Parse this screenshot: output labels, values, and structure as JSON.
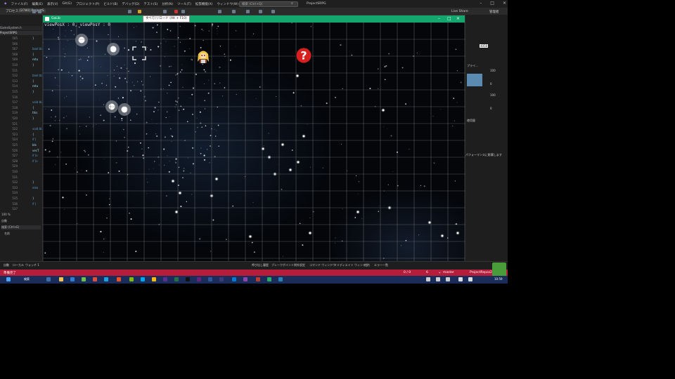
{
  "ide": {
    "menu": [
      "ファイル(F)",
      "編集(E)",
      "表示(V)",
      "Git(G)",
      "プロジェクト(P)",
      "ビルド(B)",
      "デバッグ(D)",
      "テスト(S)",
      "分析(N)",
      "ツール(T)",
      "拡張機能(X)",
      "ウィンドウ(W)",
      "ヘルプ(H)"
    ],
    "search_placeholder": "検索 (Ctrl+Q)",
    "project_title": "ProjectSRPG",
    "live_share": "Live Share",
    "admin": "管理者",
    "toolbar_process_label": "プロセス:",
    "toolbar_process_value": "[2780] ProjectS",
    "tab_label": "GameSystem.h",
    "file_tab": "ProjectSRPG",
    "line_numbers": [
      505,
      506,
      507,
      508,
      509,
      510,
      511,
      512,
      513,
      514,
      515,
      516,
      517,
      518,
      519,
      520,
      521,
      522,
      523,
      524,
      525,
      526,
      527,
      528,
      529,
      530,
      531,
      532,
      533,
      534,
      535,
      536,
      537
    ],
    "code_lines": [
      "}",
      "",
      "bool bUni",
      "{",
      "retu",
      "}",
      "",
      "bool bUni",
      "{",
      "retu",
      "}",
      "",
      "void bUni",
      "{",
      "this",
      "}",
      "",
      "void bUni",
      "{",
      "if (",
      "bIs",
      "vecT",
      "if (s",
      "if (s",
      "",
      "",
      "",
      "}",
      "else",
      "",
      "}",
      "if (",
      ""
    ],
    "zoom": "100 %",
    "bottom_panel_title": "自動",
    "bottom_panel_search": "検索 (Ctrl+E)",
    "bottom_panel_name": "名前",
    "bottom_tabs_left": [
      "自動",
      "ローカル",
      "ウォッチ 1"
    ],
    "bottom_tabs_right": [
      "呼び出し履歴",
      "ブレークポイント",
      "例外設定",
      "コマンド ウィンドウ",
      "イミディエイト ウィンドウ",
      "出力",
      "エラー一覧"
    ],
    "status_ready": "準備完了",
    "status_counter": "0 / 0",
    "status_errors": "6",
    "status_branch": "master",
    "status_repo": "ProjectRepos2",
    "right_panel": {
      "value_top": "4050",
      "label_process": "プライ...",
      "num_100_a": "100",
      "num_0_a": "0",
      "num_100_b": "100",
      "num_0_b": "0",
      "usage": "使用量",
      "perf_note": "パフォーマンスに影響します"
    },
    "taskbar_search": "検索",
    "clock": "10:59",
    "accent_statusbar": "#b51d3a",
    "accent_game_title": "#13a76d"
  },
  "game": {
    "window_title": "GaLib",
    "view_pos_text": "viewPosX : 0, viewPosY : 0",
    "tooltip": "すべて(リロード (Alt + F10)",
    "grid_color": "#6e6e6e",
    "sprites": {
      "hero": "character-sprite",
      "unknown": "question-mark-icon",
      "selection": "selection-cursor"
    }
  }
}
